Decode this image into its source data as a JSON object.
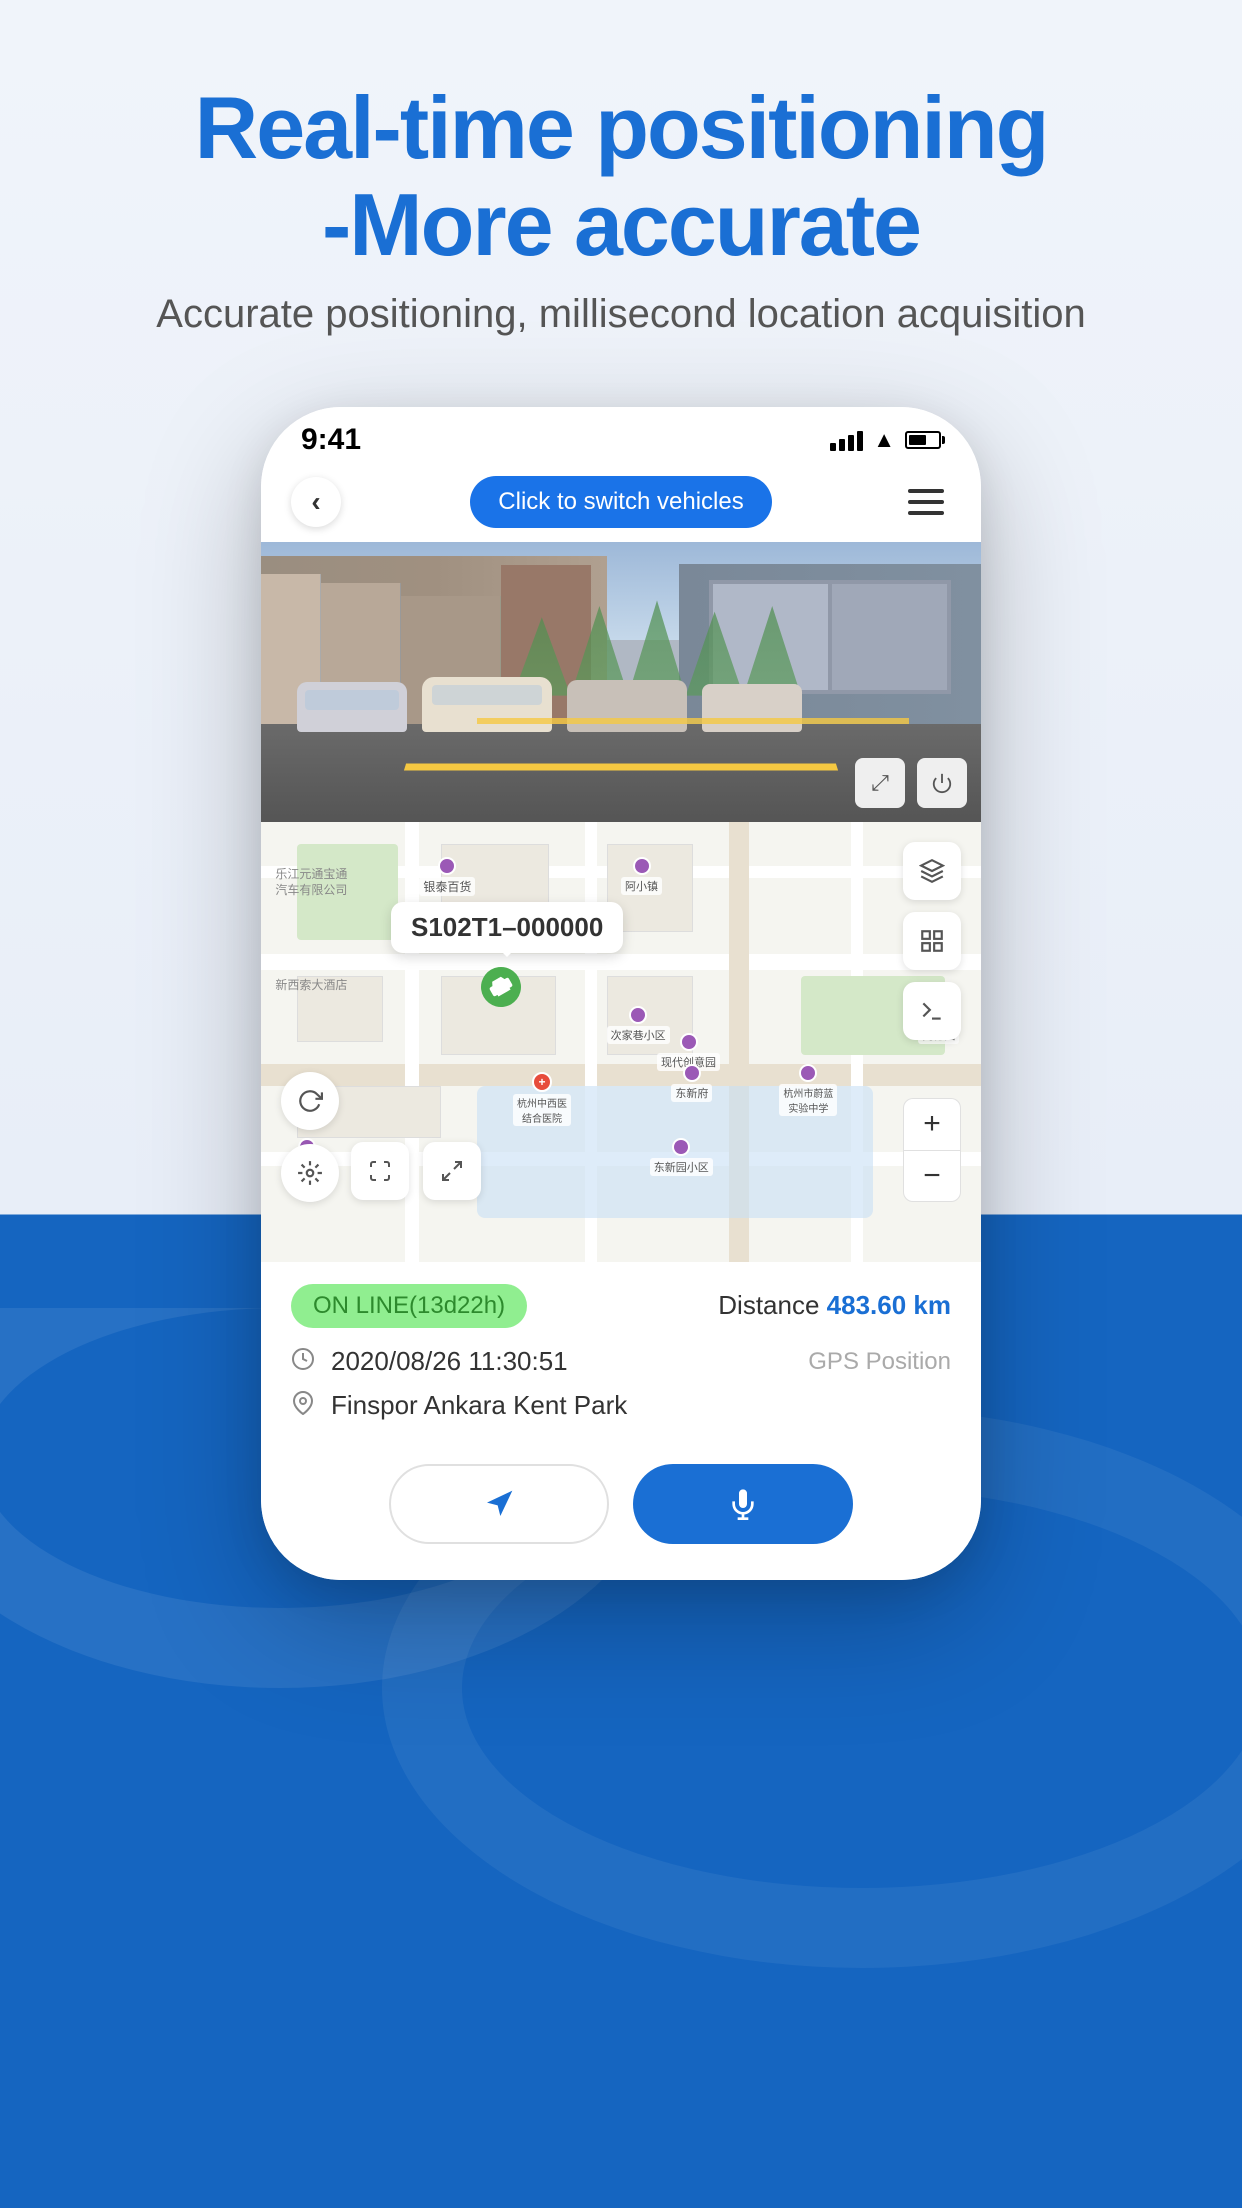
{
  "hero": {
    "title_line1": "Real-time positioning",
    "title_line2": "-More accurate",
    "subtitle": "Accurate positioning, millisecond location acquisition"
  },
  "phone": {
    "status_bar": {
      "time": "9:41",
      "signal_label": "signal",
      "wifi_label": "wifi",
      "battery_label": "battery"
    },
    "nav": {
      "back_label": "‹",
      "switch_vehicles_label": "Click to switch vehicles",
      "menu_label": "menu"
    },
    "street_view": {
      "expand_icon": "⤢",
      "power_icon": "⏻"
    },
    "map": {
      "vehicle_id": "S102T1–000000",
      "layers_icon": "layers",
      "road_icon": "road",
      "terminal_icon": "terminal",
      "refresh_icon": "↻",
      "location_icon": "◎",
      "frame_full_icon": "⛶",
      "frame_icon": "▢",
      "zoom_plus": "+",
      "zoom_minus": "−"
    },
    "info": {
      "status_label": "ON LINE(13d22h)",
      "distance_label": "Distance",
      "distance_value": "483.60",
      "distance_unit": "km",
      "datetime": "2020/08/26 11:30:51",
      "gps_position": "GPS Position",
      "location_name": "Finspor Ankara Kent Park"
    },
    "actions": {
      "navigate_icon": "➤",
      "mic_icon": "🎤"
    }
  }
}
